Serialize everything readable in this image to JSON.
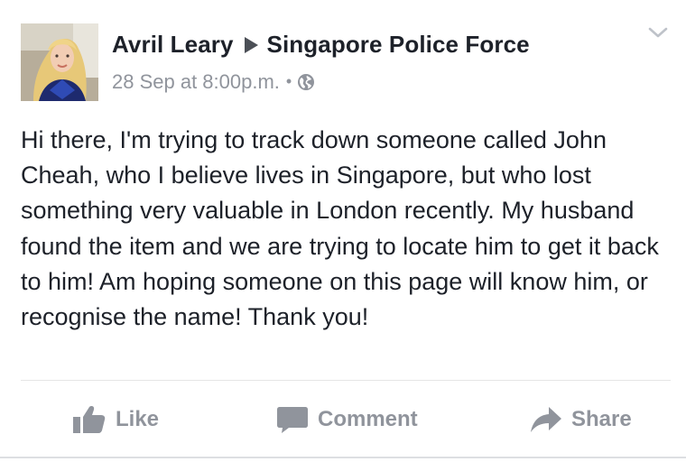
{
  "post": {
    "author": "Avril Leary",
    "target_page": "Singapore Police Force",
    "timestamp": "28 Sep at 8:00p.m.",
    "separator": "•",
    "privacy_icon": "globe-icon",
    "menu_icon": "chevron-down-icon",
    "avatar_icon": "profile-photo",
    "body": "Hi there, I'm trying to track down someone called John Cheah, who I believe lives in Singapore, but who lost something very valuable in London recently. My husband found the item and we are trying to locate him to get it back to him! Am hoping someone on this page will know him, or recognise the name! Thank you!"
  },
  "actions": {
    "like_label": "Like",
    "like_icon": "thumbs-up-icon",
    "comment_label": "Comment",
    "comment_icon": "comment-bubble-icon",
    "share_label": "Share",
    "share_icon": "share-arrow-icon"
  },
  "colors": {
    "text_primary": "#1d2129",
    "text_secondary": "#90949c",
    "divider": "#e5e5e5"
  }
}
